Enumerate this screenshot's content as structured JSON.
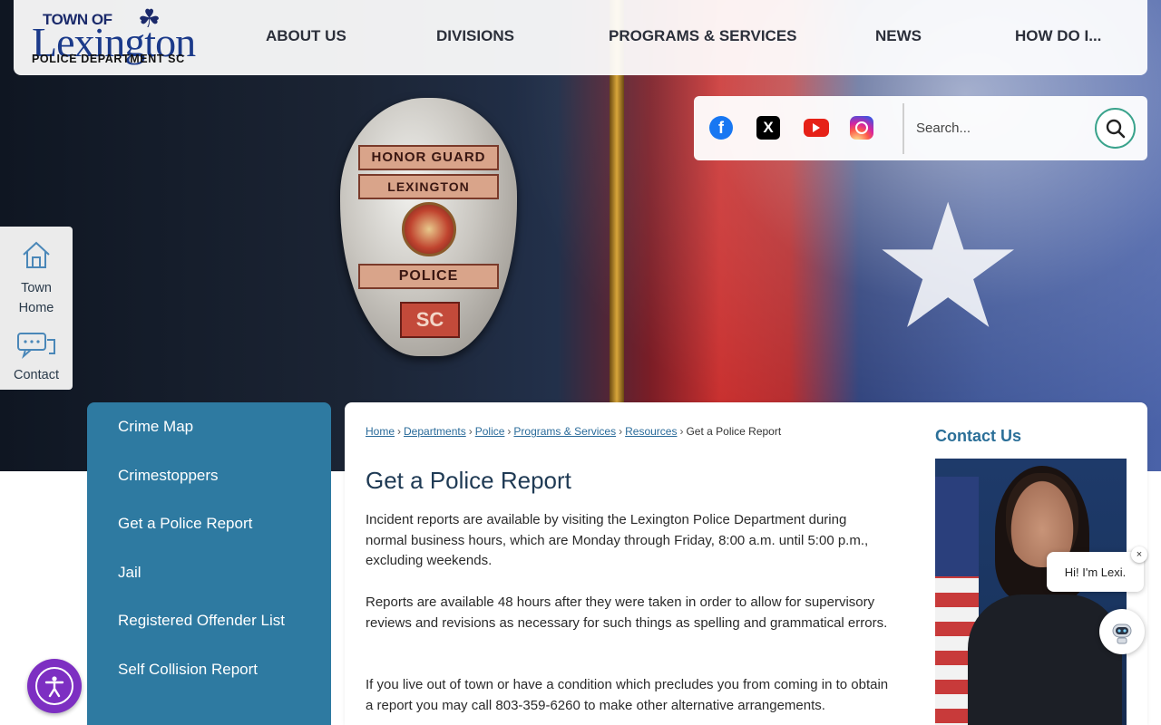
{
  "logo": {
    "line1": "TOWN OF",
    "line2": "Lexington",
    "line3": "POLICE DEPARTMENT  SC"
  },
  "nav": {
    "items": [
      {
        "label": "ABOUT US"
      },
      {
        "label": "DIVISIONS"
      },
      {
        "label": "PROGRAMS & SERVICES"
      },
      {
        "label": "NEWS"
      },
      {
        "label": "HOW DO I..."
      }
    ]
  },
  "hero": {
    "badge_top": "HONOR GUARD",
    "badge_mid": "LEXINGTON",
    "badge_low": "POLICE",
    "badge_sc": "SC"
  },
  "search": {
    "placeholder": "Search..."
  },
  "social": {
    "facebook": "facebook-icon",
    "x": "x-icon",
    "youtube": "youtube-icon",
    "instagram": "instagram-icon"
  },
  "quick_links": {
    "town_home": "Town Home",
    "contact": "Contact"
  },
  "sidebar": {
    "items": [
      {
        "label": "Crime Map"
      },
      {
        "label": "Crimestoppers"
      },
      {
        "label": "Get a Police Report"
      },
      {
        "label": "Jail"
      },
      {
        "label": "Registered Offender List"
      },
      {
        "label": "Self Collision Report"
      }
    ]
  },
  "breadcrumb": {
    "items": [
      "Home",
      "Departments",
      "Police",
      "Programs & Services",
      "Resources"
    ],
    "current": "Get a Police Report"
  },
  "page": {
    "title": "Get a Police Report",
    "paragraphs": [
      "Incident reports are available by visiting the Lexington Police Department during normal business hours, which are Monday through Friday, 8:00 a.m. until 5:00 p.m., excluding weekends.",
      "Reports are available 48 hours after they were taken in order to allow for supervisory reviews and revisions as necessary for such things as spelling and grammatical errors.",
      "If you live out of town or have a condition which precludes you from coming in to obtain a report you may call 803-359-6260 to make other alternative arrangements."
    ]
  },
  "contact": {
    "heading": "Contact Us"
  },
  "chat": {
    "greeting": "Hi! I'm Lexi.",
    "close": "×"
  },
  "colors": {
    "sidebar": "#2e7aa1",
    "title": "#1f3a54",
    "link": "#2a6b9a",
    "accessibility": "#7d2fc2"
  }
}
